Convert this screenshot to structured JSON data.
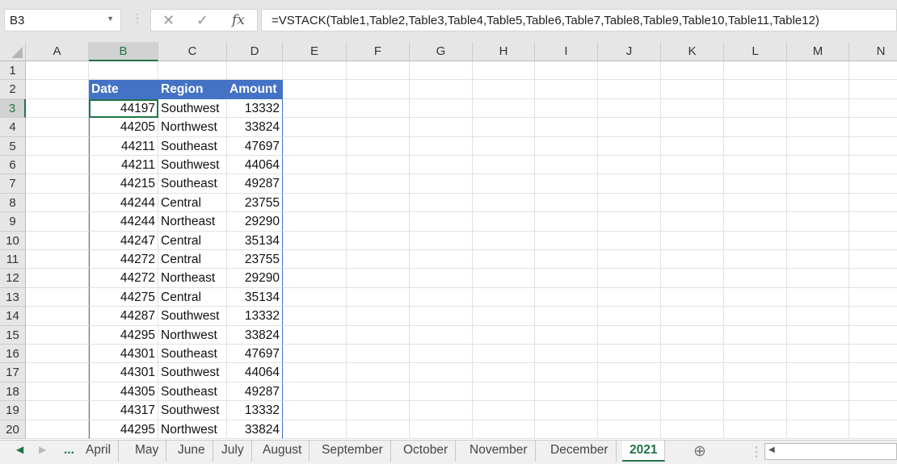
{
  "name_box": "B3",
  "formula": "=VSTACK(Table1,Table2,Table3,Table4,Table5,Table6,Table7,Table8,Table9,Table10,Table11,Table12)",
  "icons": {
    "cancel": "✕",
    "enter": "✓",
    "fx": "fx"
  },
  "columns": [
    "A",
    "B",
    "C",
    "D",
    "E",
    "F",
    "G",
    "H",
    "I",
    "J",
    "K",
    "L",
    "M",
    "N"
  ],
  "selected_column": "B",
  "selected_row": 3,
  "table": {
    "headers": [
      "Date",
      "Region",
      "Amount"
    ],
    "rows": [
      [
        "44197",
        "Southwest",
        "13332"
      ],
      [
        "44205",
        "Northwest",
        "33824"
      ],
      [
        "44211",
        "Southeast",
        "47697"
      ],
      [
        "44211",
        "Southwest",
        "44064"
      ],
      [
        "44215",
        "Southeast",
        "49287"
      ],
      [
        "44244",
        "Central",
        "23755"
      ],
      [
        "44244",
        "Northeast",
        "29290"
      ],
      [
        "44247",
        "Central",
        "35134"
      ],
      [
        "44272",
        "Central",
        "23755"
      ],
      [
        "44272",
        "Northeast",
        "29290"
      ],
      [
        "44275",
        "Central",
        "35134"
      ],
      [
        "44287",
        "Southwest",
        "13332"
      ],
      [
        "44295",
        "Northwest",
        "33824"
      ],
      [
        "44301",
        "Southeast",
        "47697"
      ],
      [
        "44301",
        "Southwest",
        "44064"
      ],
      [
        "44305",
        "Southeast",
        "49287"
      ],
      [
        "44317",
        "Southwest",
        "13332"
      ],
      [
        "44295",
        "Northwest",
        "33824"
      ]
    ]
  },
  "sheet_tabs": [
    "...",
    "April",
    "May",
    "June",
    "July",
    "August",
    "September",
    "October",
    "November",
    "December",
    "2021"
  ],
  "active_tab": "2021",
  "accent": "#217346",
  "table_header_color": "#4472c4"
}
